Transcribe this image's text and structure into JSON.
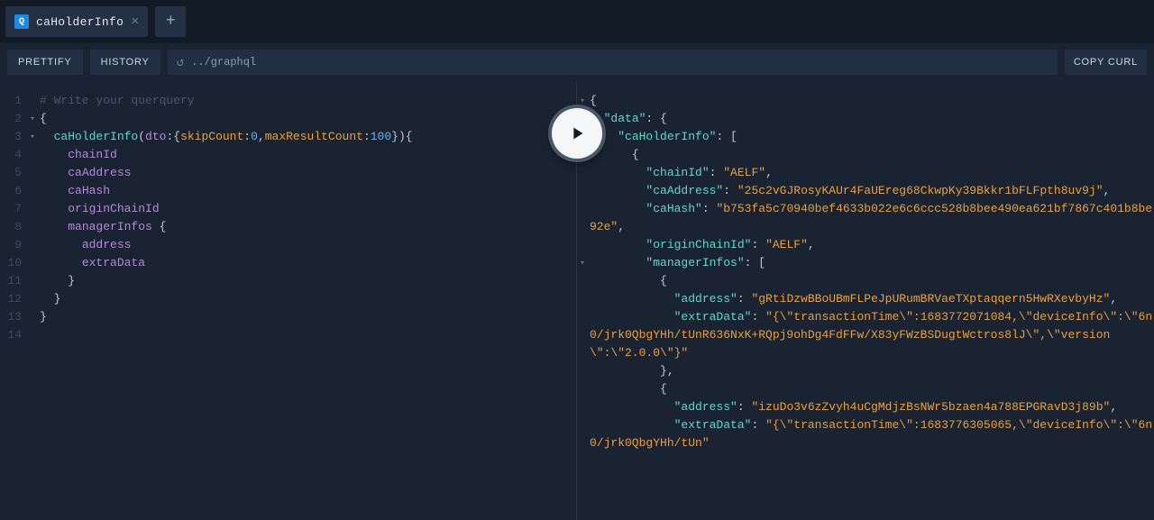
{
  "tab": {
    "icon_letter": "Q",
    "title": "caHolderInfo"
  },
  "toolbar": {
    "prettify": "PRETTIFY",
    "history": "HISTORY",
    "url": "../graphql",
    "copy_curl": "COPY CURL"
  },
  "editor_lines": [
    {
      "n": "1",
      "fold": "",
      "html": "<span class='c-comment'># Write your querquery</span>"
    },
    {
      "n": "2",
      "fold": "▾",
      "html": "<span class='c-punc'>{</span>"
    },
    {
      "n": "3",
      "fold": "▾",
      "html": "  <span class='c-name'>caHolderInfo</span><span class='c-punc'>(</span><span class='c-field'>dto</span><span class='c-punc'>:{</span><span class='c-param'>skipCount</span><span class='c-punc'>:</span><span class='c-num'>0</span><span class='c-punc'>,</span><span class='c-param'>maxResultCount</span><span class='c-punc'>:</span><span class='c-num'>100</span><span class='c-punc'>}){</span>"
    },
    {
      "n": "4",
      "fold": "",
      "html": "    <span class='c-field'>chainId</span>"
    },
    {
      "n": "5",
      "fold": "",
      "html": "    <span class='c-field'>caAddress</span>"
    },
    {
      "n": "6",
      "fold": "",
      "html": "    <span class='c-field'>caHash</span>"
    },
    {
      "n": "7",
      "fold": "",
      "html": "    <span class='c-field'>originChainId</span>"
    },
    {
      "n": "8",
      "fold": "",
      "html": "    <span class='c-field'>managerInfos</span> <span class='c-punc'>{</span>"
    },
    {
      "n": "9",
      "fold": "",
      "html": "      <span class='c-field'>address</span>"
    },
    {
      "n": "10",
      "fold": "",
      "html": "      <span class='c-field'>extraData</span>"
    },
    {
      "n": "11",
      "fold": "",
      "html": "    <span class='c-punc'>}</span>"
    },
    {
      "n": "12",
      "fold": "",
      "html": "  <span class='c-punc'>}</span>"
    },
    {
      "n": "13",
      "fold": "",
      "html": "<span class='c-punc'>}</span>"
    },
    {
      "n": "14",
      "fold": "",
      "html": ""
    }
  ],
  "viewer_lines": [
    {
      "fold": "▾",
      "html": "<span class='c-punc'>{</span>"
    },
    {
      "fold": "▾",
      "html": "  <span class='c-key'>\"data\"</span><span class='c-punc'>: {</span>"
    },
    {
      "fold": "▾",
      "html": "    <span class='c-key'>\"caHolderInfo\"</span><span class='c-punc'>: [</span>"
    },
    {
      "fold": "▾",
      "html": "      <span class='c-punc'>{</span>"
    },
    {
      "fold": "",
      "html": "        <span class='c-key'>\"chainId\"</span><span class='c-punc'>: </span><span class='c-str'>\"AELF\"</span><span class='c-punc'>,</span>"
    },
    {
      "fold": "",
      "html": "        <span class='c-key'>\"caAddress\"</span><span class='c-punc'>: </span><span class='c-str'>\"25c2vGJRosyKAUr4FaUEreg68CkwpKy39Bkkr1bFLFpth8uv9j\"</span><span class='c-punc'>,</span>"
    },
    {
      "fold": "",
      "html": "        <span class='c-key'>\"caHash\"</span><span class='c-punc'>: </span><span class='c-str'>\"b753fa5c70940bef4633b022e6c6ccc528b8bee490ea621bf7867c401b8be92e\"</span><span class='c-punc'>,</span>"
    },
    {
      "fold": "",
      "html": "        <span class='c-key'>\"originChainId\"</span><span class='c-punc'>: </span><span class='c-str'>\"AELF\"</span><span class='c-punc'>,</span>"
    },
    {
      "fold": "▾",
      "html": "        <span class='c-key'>\"managerInfos\"</span><span class='c-punc'>: [</span>"
    },
    {
      "fold": "",
      "html": "          <span class='c-punc'>{</span>"
    },
    {
      "fold": "",
      "html": "            <span class='c-key'>\"address\"</span><span class='c-punc'>: </span><span class='c-str'>\"gRtiDzwBBoUBmFLPeJpURumBRVaeTXptaqqern5HwRXevbyHz\"</span><span class='c-punc'>,</span>"
    },
    {
      "fold": "",
      "html": "            <span class='c-key'>\"extraData\"</span><span class='c-punc'>: </span><span class='c-str'>\"{\\\"transactionTime\\\":1683772071084,\\\"deviceInfo\\\":\\\"6n0/jrk0QbgYHh/tUnR636NxK+RQpj9ohDg4FdFFw/X83yFWzBSDugtWctros8lJ\\\",\\\"version\\\":\\\"2.0.0\\\"}\"</span>"
    },
    {
      "fold": "",
      "html": "          <span class='c-punc'>},</span>"
    },
    {
      "fold": "",
      "html": "          <span class='c-punc'>{</span>"
    },
    {
      "fold": "",
      "html": "            <span class='c-key'>\"address\"</span><span class='c-punc'>: </span><span class='c-str'>\"izuDo3v6zZvyh4uCgMdjzBsNWr5bzaen4a788EPGRavD3j89b\"</span><span class='c-punc'>,</span>"
    },
    {
      "fold": "",
      "html": "            <span class='c-key'>\"extraData\"</span><span class='c-punc'>: </span><span class='c-str'>\"{\\\"transactionTime\\\":1683776305065,\\\"deviceInfo\\\":\\\"6n0/jrk0QbgYHh/tUn\"</span>"
    }
  ]
}
